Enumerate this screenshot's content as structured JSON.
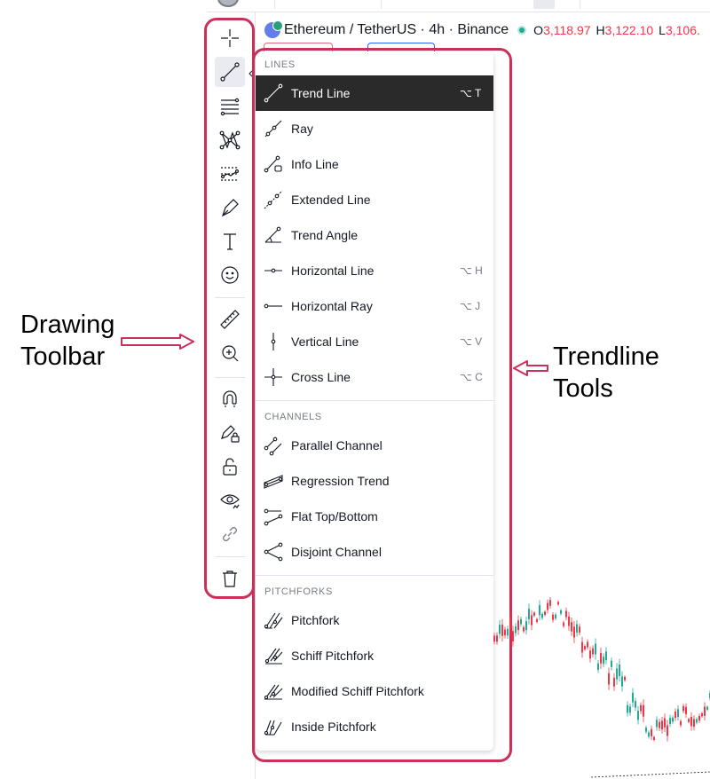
{
  "header": {
    "symbol": "Ethereum / TetherUS · 4h · Binance",
    "ohlc": [
      {
        "label": "O",
        "value": "3,118.97"
      },
      {
        "label": "H",
        "value": "3,122.10"
      },
      {
        "label": "L",
        "value": "3,106."
      }
    ],
    "colors": {
      "down": "#f23645",
      "live": "#22ab94"
    }
  },
  "toolbar": {
    "tools": [
      "crosshair-icon",
      "trend-line-icon",
      "fib-retracement-icon",
      "pattern-icon",
      "prediction-icon",
      "brush-icon",
      "text-icon",
      "emoji-icon",
      "ruler-icon",
      "zoom-in-icon",
      "magnet-icon",
      "lock-drawing-icon",
      "unlock-icon",
      "eye-icon",
      "link-icon",
      "trash-icon"
    ],
    "active_tool": "trend-line-icon"
  },
  "menu": {
    "sections": [
      {
        "title": "LINES",
        "items": [
          {
            "label": "Trend Line",
            "shortcut": "⌥ T",
            "icon": "trend-line-icon",
            "active": true
          },
          {
            "label": "Ray",
            "shortcut": "",
            "icon": "ray-icon"
          },
          {
            "label": "Info Line",
            "shortcut": "",
            "icon": "info-line-icon"
          },
          {
            "label": "Extended Line",
            "shortcut": "",
            "icon": "extended-line-icon"
          },
          {
            "label": "Trend Angle",
            "shortcut": "",
            "icon": "trend-angle-icon"
          },
          {
            "label": "Horizontal Line",
            "shortcut": "⌥ H",
            "icon": "horizontal-line-icon"
          },
          {
            "label": "Horizontal Ray",
            "shortcut": "⌥ J",
            "icon": "horizontal-ray-icon"
          },
          {
            "label": "Vertical Line",
            "shortcut": "⌥ V",
            "icon": "vertical-line-icon"
          },
          {
            "label": "Cross Line",
            "shortcut": "⌥ C",
            "icon": "cross-line-icon"
          }
        ]
      },
      {
        "title": "CHANNELS",
        "items": [
          {
            "label": "Parallel Channel",
            "shortcut": "",
            "icon": "parallel-channel-icon"
          },
          {
            "label": "Regression Trend",
            "shortcut": "",
            "icon": "regression-trend-icon"
          },
          {
            "label": "Flat Top/Bottom",
            "shortcut": "",
            "icon": "flat-top-bottom-icon"
          },
          {
            "label": "Disjoint Channel",
            "shortcut": "",
            "icon": "disjoint-channel-icon"
          }
        ]
      },
      {
        "title": "PITCHFORKS",
        "items": [
          {
            "label": "Pitchfork",
            "shortcut": "",
            "icon": "pitchfork-icon"
          },
          {
            "label": "Schiff Pitchfork",
            "shortcut": "",
            "icon": "schiff-pitchfork-icon"
          },
          {
            "label": "Modified Schiff Pitchfork",
            "shortcut": "",
            "icon": "modified-schiff-pitchfork-icon"
          },
          {
            "label": "Inside Pitchfork",
            "shortcut": "",
            "icon": "inside-pitchfork-icon"
          }
        ]
      }
    ]
  },
  "annotations": {
    "drawing_toolbar": [
      "Drawing",
      "Toolbar"
    ],
    "trendline_tools": [
      "Trendline",
      "Tools"
    ],
    "color": "#c8325a"
  }
}
